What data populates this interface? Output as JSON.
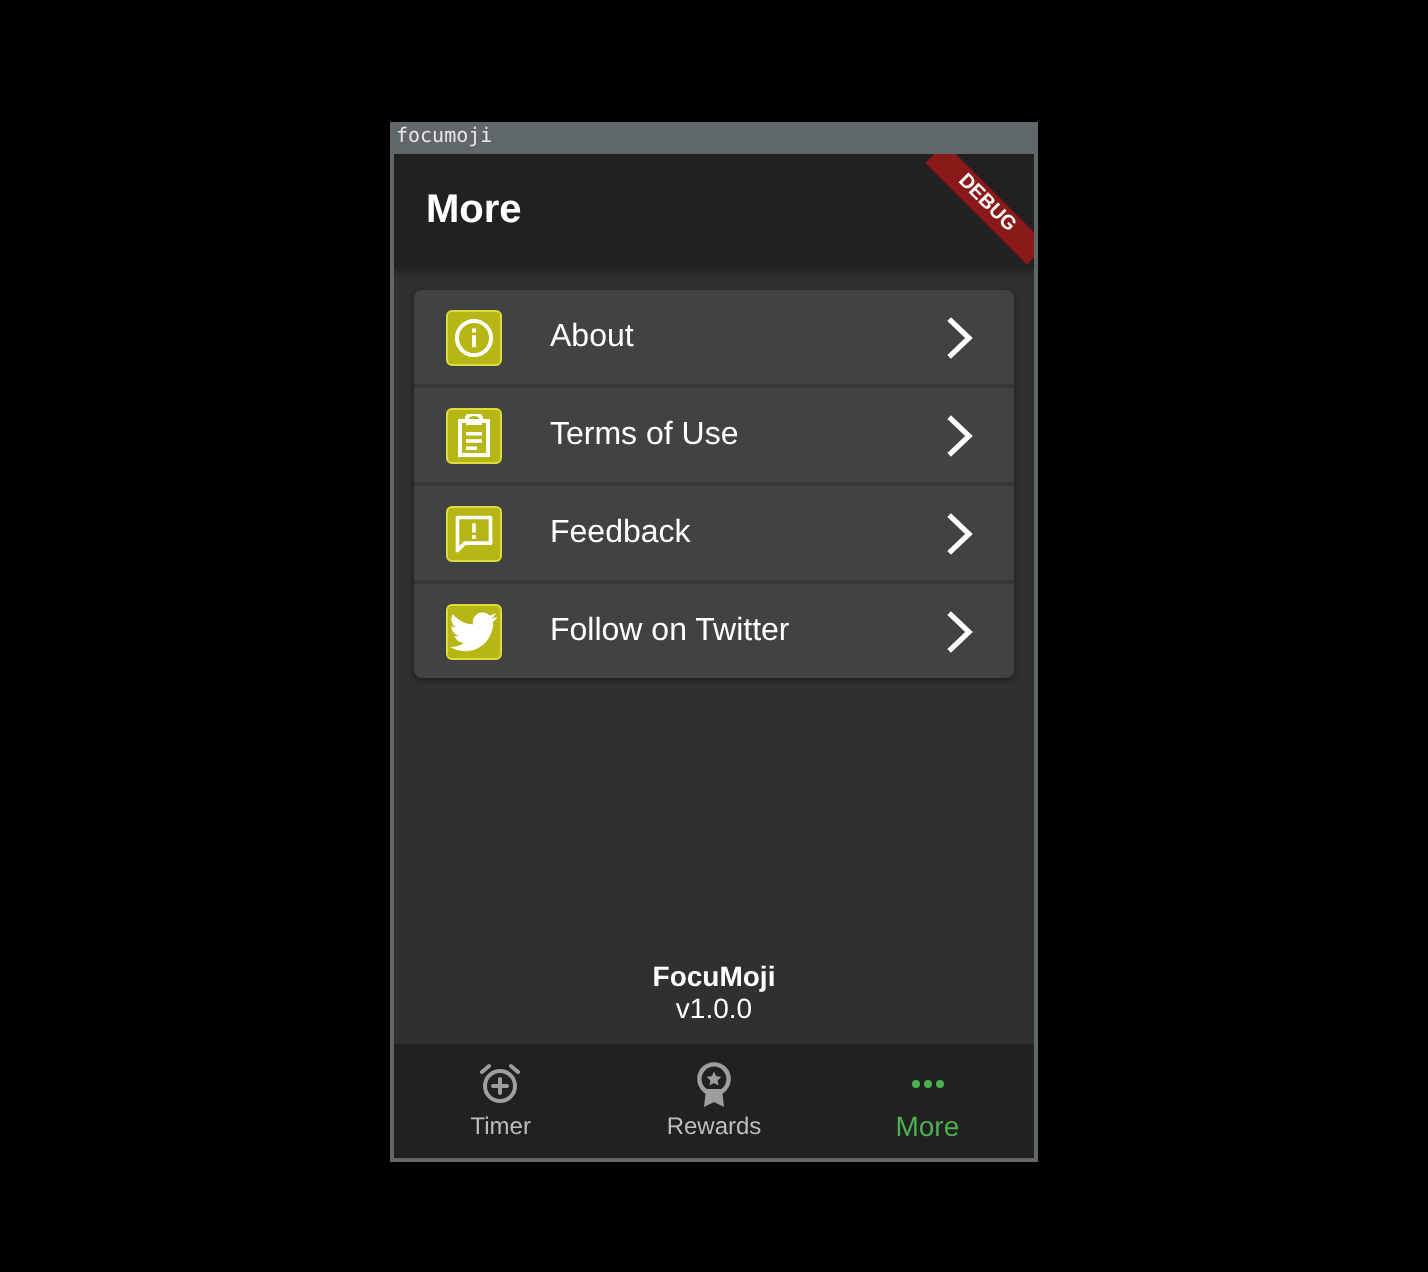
{
  "window": {
    "title": "focumoji"
  },
  "app_bar": {
    "title": "More",
    "debug_banner": "DEBUG"
  },
  "menu": {
    "items": [
      {
        "label": "About"
      },
      {
        "label": "Terms of Use"
      },
      {
        "label": "Feedback"
      },
      {
        "label": "Follow on Twitter"
      }
    ]
  },
  "footer": {
    "app_name": "FocuMoji",
    "version": "v1.0.0"
  },
  "bottom_nav": {
    "tabs": [
      {
        "label": "Timer",
        "selected": false
      },
      {
        "label": "Rewards",
        "selected": false
      },
      {
        "label": "More",
        "selected": true
      }
    ]
  }
}
